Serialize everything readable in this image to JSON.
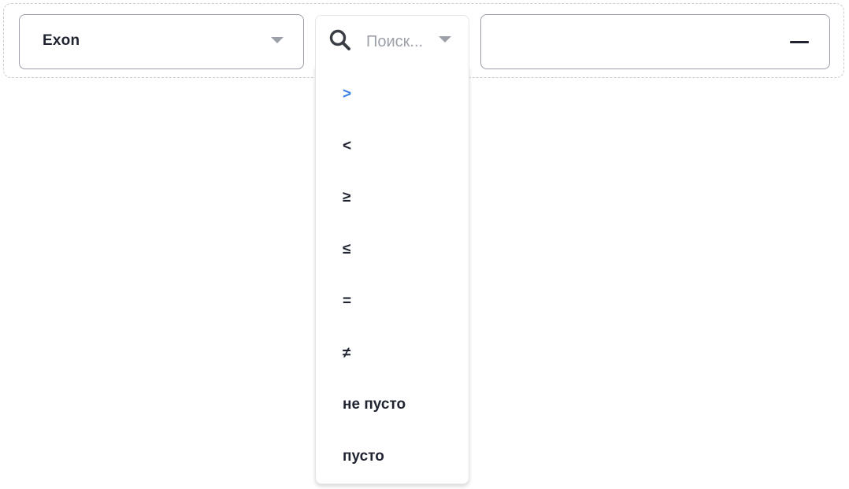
{
  "filter": {
    "field": {
      "value": "Exon",
      "caret_icon": "caret-down-icon"
    },
    "operator": {
      "search_icon": "search-icon",
      "placeholder": "Поиск...",
      "value": "",
      "caret_icon": "caret-down-icon",
      "options": [
        {
          "label": ">",
          "highlighted": true
        },
        {
          "label": "<",
          "highlighted": false
        },
        {
          "label": "≥",
          "highlighted": false
        },
        {
          "label": "≤",
          "highlighted": false
        },
        {
          "label": "=",
          "highlighted": false
        },
        {
          "label": "≠",
          "highlighted": false
        },
        {
          "label": "не пусто",
          "highlighted": false
        },
        {
          "label": "пусто",
          "highlighted": false
        }
      ]
    },
    "value_input": {
      "value": "",
      "remove_icon": "minus-icon"
    }
  },
  "colors": {
    "accent": "#3b82e6",
    "text": "#1f2430",
    "muted": "#9ca0a8",
    "border": "#9a9ea8"
  }
}
